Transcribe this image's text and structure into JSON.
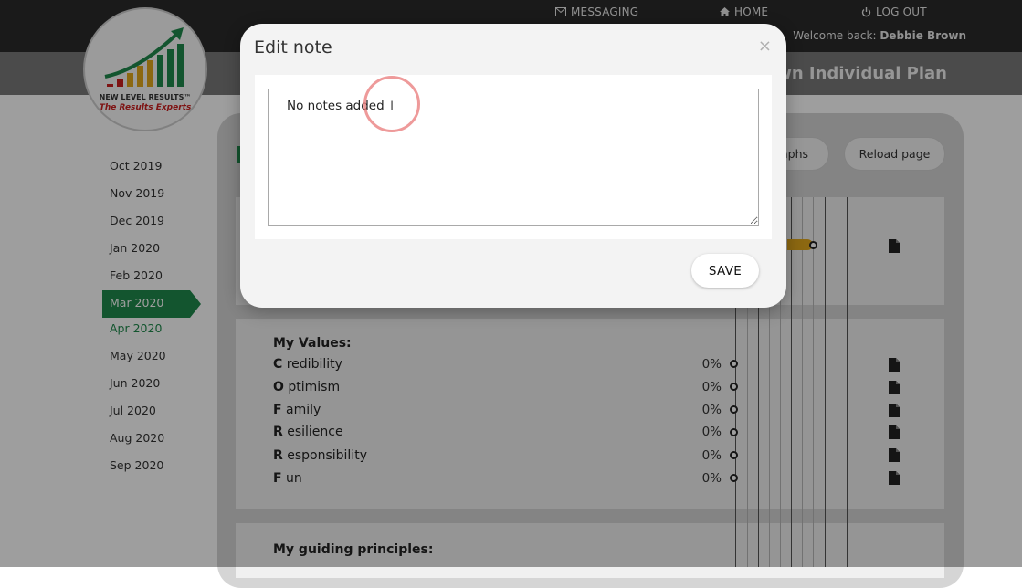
{
  "nav": {
    "messaging": "MESSAGING",
    "home": "HOME",
    "logout": "LOG OUT",
    "welcome_prefix": "Welcome back:",
    "user_name": "Debbie Brown"
  },
  "plan_title": "own Individual Plan",
  "logo": {
    "brand": "NEW LEVEL RESULTS™",
    "tagline": "The Results Experts"
  },
  "months": [
    "Oct 2019",
    "Nov 2019",
    "Dec 2019",
    "Jan 2020",
    "Feb 2020",
    "Mar 2020",
    "Apr 2020",
    "May 2020",
    "Jun 2020",
    "Jul 2020",
    "Aug 2020",
    "Sep 2020"
  ],
  "active_month": "Mar 2020",
  "toolbar": {
    "graphs_label": "aphs",
    "reload_label": "Reload page"
  },
  "values_section": {
    "title": "My Values:",
    "items": [
      {
        "initial": "C",
        "rest": " redibility",
        "pct": "0%"
      },
      {
        "initial": "O",
        "rest": " ptimism",
        "pct": "0%"
      },
      {
        "initial": "F",
        "rest": " amily",
        "pct": "0%"
      },
      {
        "initial": "R",
        "rest": " esilience",
        "pct": "0%"
      },
      {
        "initial": "R",
        "rest": " esponsibility",
        "pct": "0%"
      },
      {
        "initial": "F",
        "rest": " un",
        "pct": "0%"
      }
    ]
  },
  "principles_section": {
    "title": "My guiding principles:"
  },
  "modal": {
    "title": "Edit note",
    "close_symbol": "×",
    "note_text": "No notes added",
    "save_label": "SAVE"
  },
  "colors": {
    "accent_green": "#1f8a4c",
    "progress_orange": "#e3a81c",
    "topbar": "#2a2a2a"
  }
}
